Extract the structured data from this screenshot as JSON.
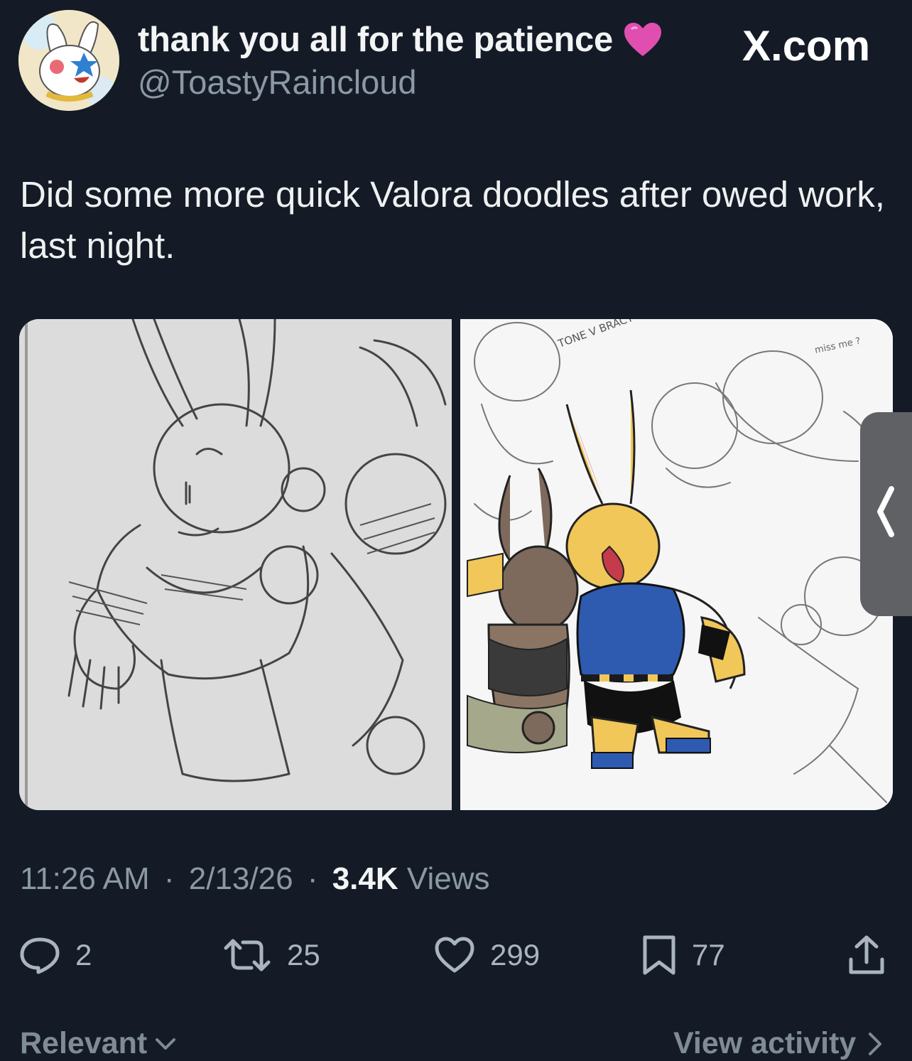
{
  "author": {
    "display_name": "thank you all for the patience",
    "handle": "@ToastyRaincloud"
  },
  "site_logo": "X.com",
  "tweet": {
    "text": "Did some more quick Valora doodles after owed work, last night."
  },
  "meta": {
    "time": "11:26 AM",
    "date": "2/13/26",
    "views_count": "3.4K",
    "views_label": "Views",
    "separator": "·"
  },
  "actions": {
    "replies": "2",
    "reposts": "25",
    "likes": "299",
    "bookmarks": "77"
  },
  "sketch_notes": {
    "note_1": "TONE V BRACT ?",
    "note_2": "miss me ?"
  },
  "footer": {
    "sort_label": "Relevant",
    "activity_label": "View activity"
  },
  "colors": {
    "background": "#141b26",
    "heart": "#e04fb0",
    "muted_text": "#8b98a5"
  },
  "icons": [
    "heart-emoji-icon",
    "reply-icon",
    "repost-icon",
    "like-icon",
    "bookmark-icon",
    "share-icon",
    "chevron-left-icon",
    "chevron-down-icon",
    "chevron-right-icon"
  ]
}
